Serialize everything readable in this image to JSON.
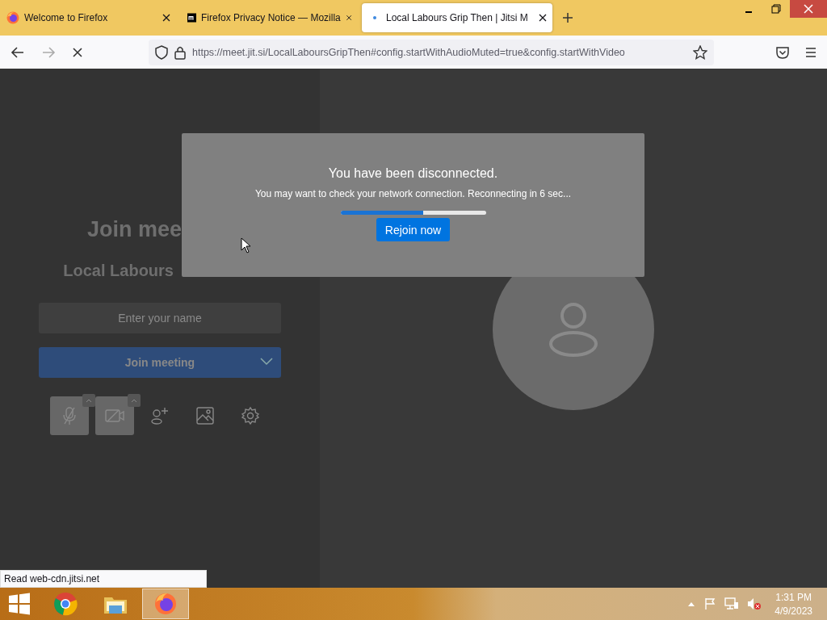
{
  "tabs": [
    {
      "title": "Welcome to Firefox",
      "selected": false
    },
    {
      "title": "Firefox Privacy Notice — Mozilla",
      "selected": false
    },
    {
      "title": "Local Labours Grip Then | Jitsi M",
      "selected": true
    }
  ],
  "address_bar": {
    "url": "https://meet.jit.si/LocalLaboursGripThen#config.startWithAudioMuted=true&config.startWithVideo"
  },
  "prejoin": {
    "heading": "Join mee",
    "meeting_name": "Local Labours",
    "name_field": {
      "placeholder": "Enter your name"
    },
    "join_button": "Join meeting"
  },
  "dialog": {
    "title": "You have been disconnected.",
    "message": "You may want to check your network connection. Reconnecting in 6 sec...",
    "progress": {
      "level": 0.57
    },
    "button": "Rejoin now"
  },
  "status_text": "Read web-cdn.jitsi.net",
  "taskbar": {
    "apps": [
      {
        "kind": "chrome",
        "selected": false
      },
      {
        "kind": "explorer",
        "selected": false
      },
      {
        "kind": "firefox",
        "selected": true
      }
    ],
    "time": "1:31 PM",
    "date": "4/9/2023"
  }
}
